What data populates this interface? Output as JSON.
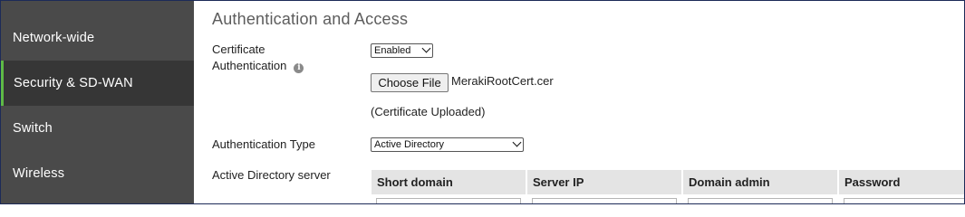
{
  "sidebar": {
    "items": [
      {
        "label": "Network-wide",
        "active": false
      },
      {
        "label": "Security & SD-WAN",
        "active": true
      },
      {
        "label": "Switch",
        "active": false
      },
      {
        "label": "Wireless",
        "active": false
      }
    ],
    "active_accent_color": "#5fb946"
  },
  "main": {
    "title": "Authentication and Access",
    "certificate_auth": {
      "label_line1": "Certificate",
      "label_line2": "Authentication",
      "info_icon": "info-icon",
      "info_glyph": "i",
      "select_value": "Enabled",
      "choose_file_label": "Choose File",
      "file_name": "MerakiRootCert.cer",
      "status_text": "(Certificate Uploaded)"
    },
    "auth_type": {
      "label": "Authentication Type",
      "select_value": "Active Directory"
    },
    "ad_server": {
      "label": "Active Directory server",
      "columns": [
        "Short domain",
        "Server IP",
        "Domain admin",
        "Password"
      ]
    }
  }
}
